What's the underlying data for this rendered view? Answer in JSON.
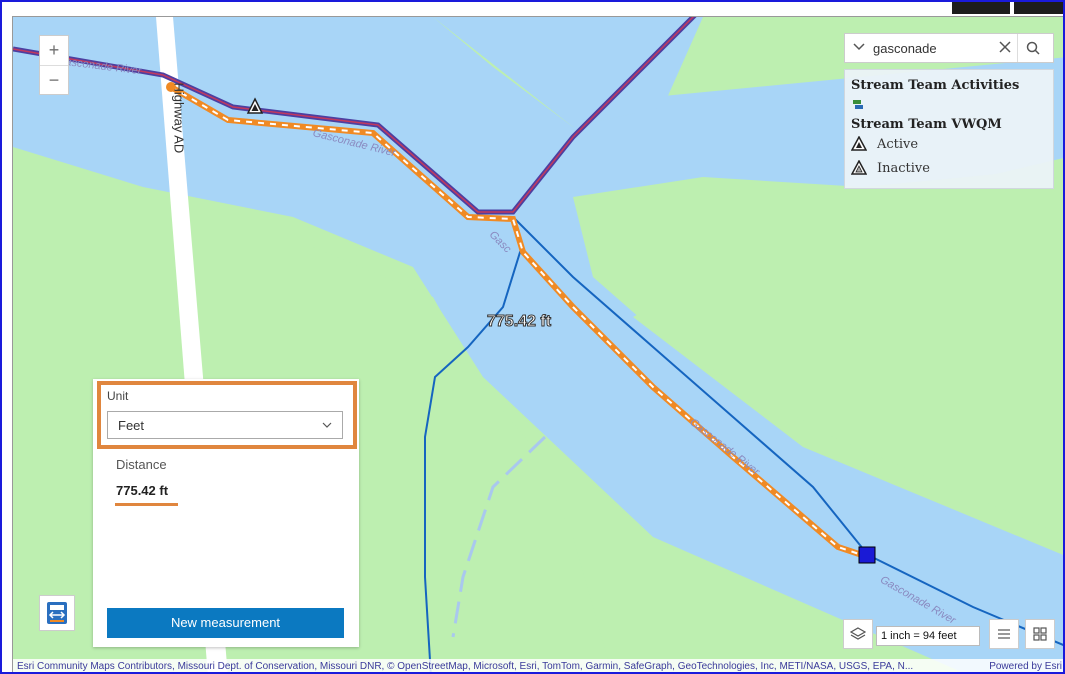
{
  "map": {
    "zoom_in": "+",
    "zoom_out": "−",
    "river_label": "Gasconade River",
    "river_label_short": "Gasc",
    "road_label": "Highway AD",
    "measure_label": "775.42 ft"
  },
  "search": {
    "value": "gasconade",
    "clear_icon": "close-icon",
    "search_icon": "search-icon"
  },
  "legend": {
    "title1": "Stream Team Activities",
    "title2": "Stream Team VWQM",
    "items": [
      {
        "label": "Active"
      },
      {
        "label": "Inactive"
      }
    ]
  },
  "measure": {
    "unit_label": "Unit",
    "unit_value": "Feet",
    "distance_label": "Distance",
    "distance_value": "775.42 ft",
    "new_button": "New measurement",
    "highlight_color": "#e0863e"
  },
  "scale": {
    "text": "1 inch =  94 feet"
  },
  "attribution": {
    "text": "Esri Community Maps Contributors, Missouri Dept. of Conservation, Missouri DNR, © OpenStreetMap, Microsoft, Esri, TomTom, Garmin, SafeGraph, GeoTechnologies, Inc, METI/NASA, USGS, EPA, N...",
    "powered": "Powered by Esri"
  },
  "colors": {
    "land": "#bdefb0",
    "water": "#a8d5f7",
    "road": "#ffffff",
    "stream": "#1565c0",
    "boundary": "#7b2e7a",
    "measure": "#f08a24",
    "button": "#0b79c1"
  }
}
